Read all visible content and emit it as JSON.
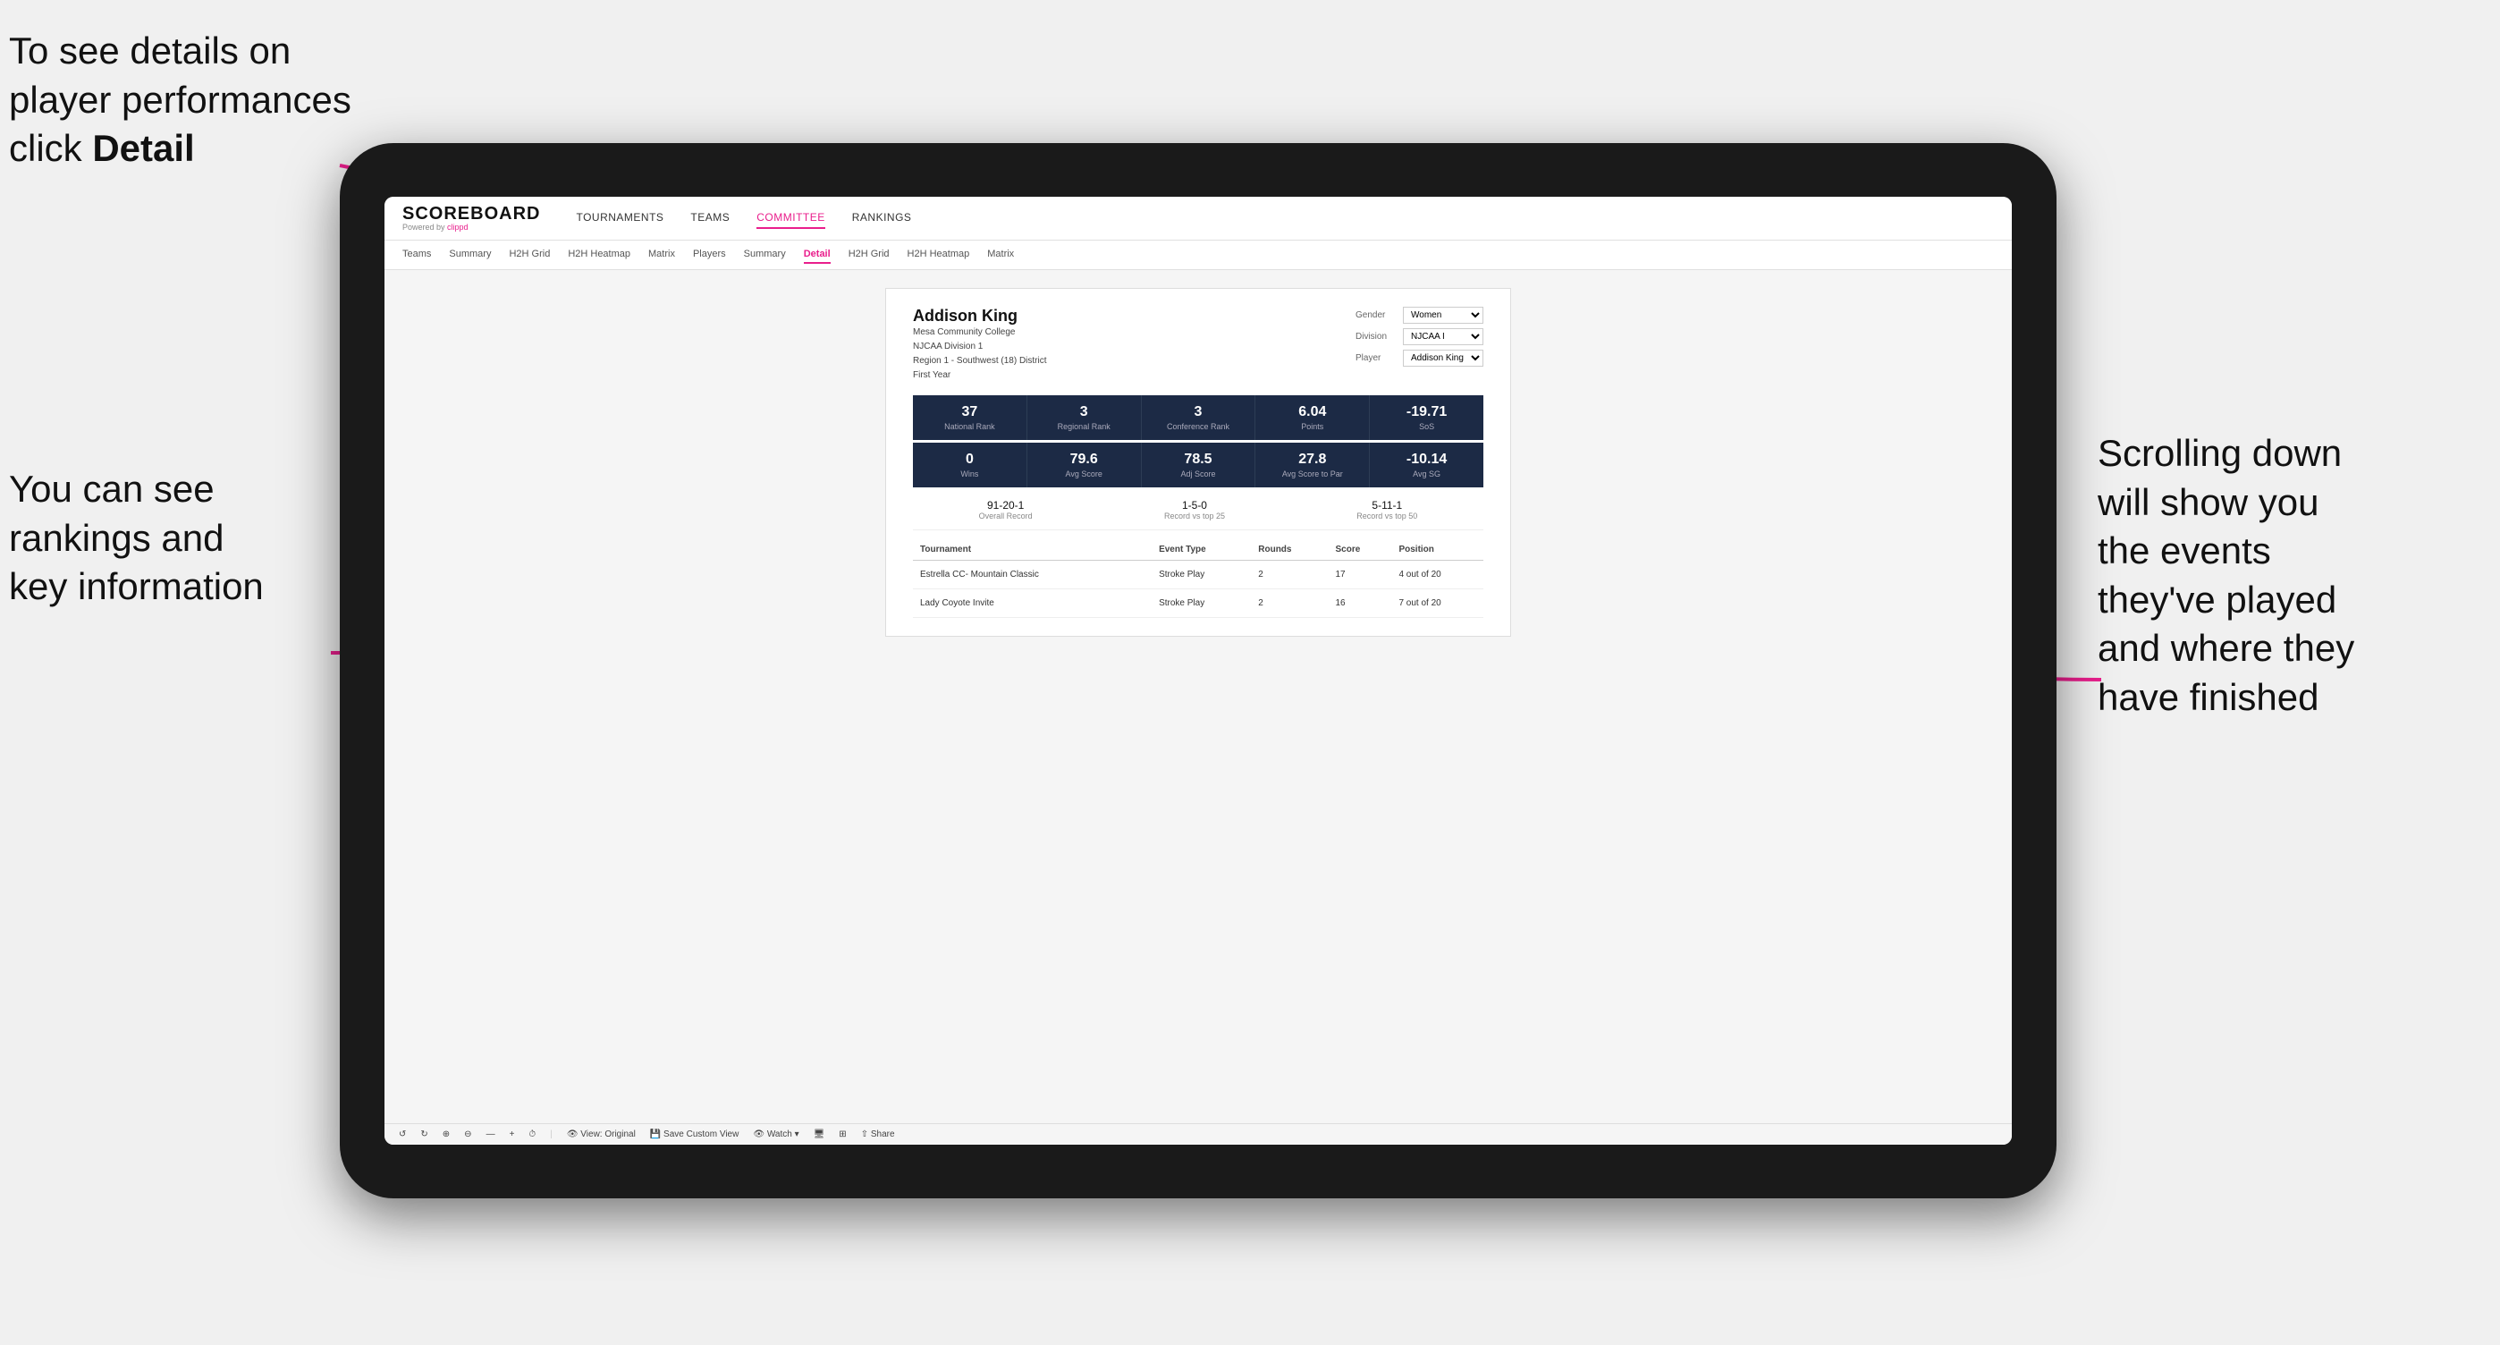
{
  "annotations": {
    "top_left": {
      "line1": "To see details on",
      "line2": "player performances",
      "line3_prefix": "click ",
      "line3_bold": "Detail"
    },
    "bottom_left": {
      "line1": "You can see",
      "line2": "rankings and",
      "line3": "key information"
    },
    "right": {
      "line1": "Scrolling down",
      "line2": "will show you",
      "line3": "the events",
      "line4": "they've played",
      "line5": "and where they",
      "line6": "have finished"
    }
  },
  "app": {
    "logo": "SCOREBOARD",
    "powered_by": "Powered by",
    "brand": "clippd",
    "main_nav": [
      "TOURNAMENTS",
      "TEAMS",
      "COMMITTEE",
      "RANKINGS"
    ],
    "active_main_nav": "COMMITTEE",
    "sub_nav": [
      "Teams",
      "Summary",
      "H2H Grid",
      "H2H Heatmap",
      "Matrix",
      "Players",
      "Summary",
      "Detail",
      "H2H Grid",
      "H2H Heatmap",
      "Matrix"
    ],
    "active_sub_nav": "Detail"
  },
  "player": {
    "name": "Addison King",
    "school": "Mesa Community College",
    "division": "NJCAA Division 1",
    "region": "Region 1 - Southwest (18) District",
    "year": "First Year",
    "gender_label": "Gender",
    "gender_value": "Women",
    "division_label": "Division",
    "division_value": "NJCAA I",
    "player_label": "Player",
    "player_value": "Addison King"
  },
  "stats_row1": [
    {
      "value": "37",
      "label": "National Rank"
    },
    {
      "value": "3",
      "label": "Regional Rank"
    },
    {
      "value": "3",
      "label": "Conference Rank"
    },
    {
      "value": "6.04",
      "label": "Points"
    },
    {
      "value": "-19.71",
      "label": "SoS"
    }
  ],
  "stats_row2": [
    {
      "value": "0",
      "label": "Wins"
    },
    {
      "value": "79.6",
      "label": "Avg Score"
    },
    {
      "value": "78.5",
      "label": "Adj Score"
    },
    {
      "value": "27.8",
      "label": "Avg Score to Par"
    },
    {
      "value": "-10.14",
      "label": "Avg SG"
    }
  ],
  "records": [
    {
      "value": "91-20-1",
      "label": "Overall Record"
    },
    {
      "value": "1-5-0",
      "label": "Record vs top 25"
    },
    {
      "value": "5-11-1",
      "label": "Record vs top 50"
    }
  ],
  "table": {
    "headers": [
      "Tournament",
      "",
      "Event Type",
      "Rounds",
      "Score",
      "Position"
    ],
    "rows": [
      {
        "tournament": "Estrella CC- Mountain Classic",
        "event_type": "Stroke Play",
        "rounds": "2",
        "score": "17",
        "position": "4 out of 20"
      },
      {
        "tournament": "Lady Coyote Invite",
        "event_type": "Stroke Play",
        "rounds": "2",
        "score": "16",
        "position": "7 out of 20"
      }
    ]
  },
  "toolbar": {
    "items": [
      "↺",
      "↻",
      "⊕",
      "⊖",
      "—",
      "+",
      "⏱",
      "View: Original",
      "Save Custom View",
      "Watch ▾",
      "🖥",
      "⊞",
      "Share"
    ]
  }
}
